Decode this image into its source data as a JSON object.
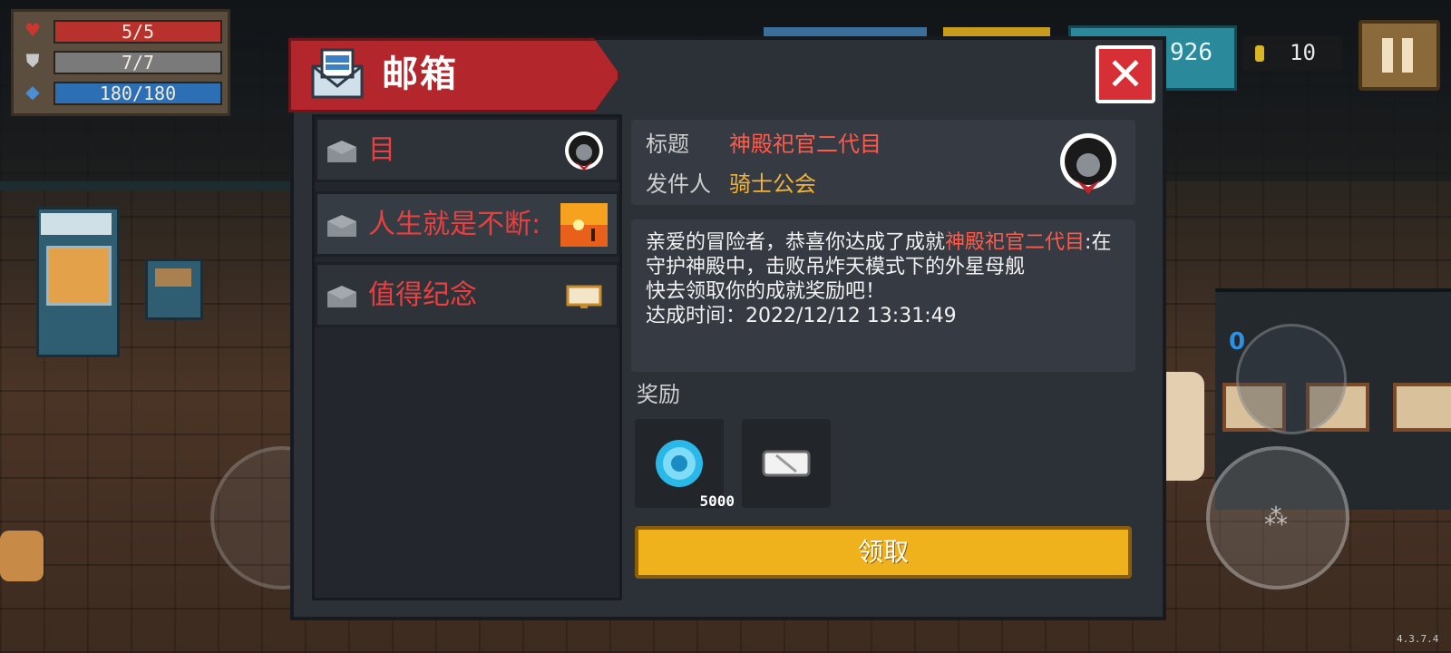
{
  "hud": {
    "hp": "5/5",
    "armor": "7/7",
    "energy": "180/180",
    "gems": "926",
    "coins": "10",
    "version": "4.3.7.4"
  },
  "controls": {
    "weapon_energy_cost": "0"
  },
  "mailbox": {
    "title": "邮箱",
    "close_symbol": "✕",
    "items": [
      {
        "label": "目",
        "selected": false
      },
      {
        "label": "人生就是不断:",
        "selected": true
      },
      {
        "label": "值得纪念",
        "selected": false
      }
    ],
    "detail": {
      "title_label": "标题",
      "title_value": "神殿祀官二代目",
      "sender_label": "发件人",
      "sender_value": "骑士公会",
      "body_intro": "亲爱的冒险者，恭喜你达成了成就",
      "body_achievement": "神殿祀官二代目",
      "body_rest": ":在守护神殿中，击败吊炸天模式下的外星母舰",
      "body_line2": "快去领取你的成就奖励吧！",
      "body_time": "达成时间：2022/12/12 13:31:49"
    },
    "rewards_label": "奖励",
    "rewards": [
      {
        "icon": "gem-icon",
        "count": "5000"
      },
      {
        "icon": "ticket-icon",
        "count": ""
      }
    ],
    "claim_label": "领取"
  },
  "colors": {
    "accent_red": "#b3262b",
    "highlight_red": "#ff5a4a",
    "sender_gold": "#f0b33a",
    "claim_yellow": "#f0b21c"
  }
}
